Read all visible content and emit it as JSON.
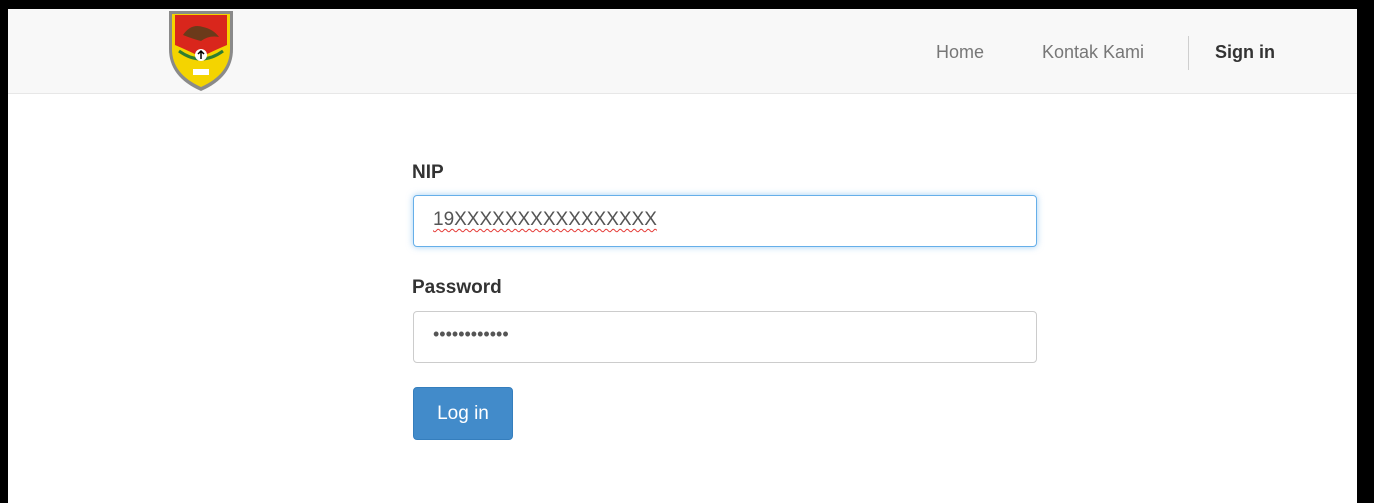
{
  "navbar": {
    "logo_icon": "regency-crest-icon",
    "links": [
      {
        "label": "Home"
      },
      {
        "label": "Kontak Kami"
      }
    ],
    "sign_in_label": "Sign in"
  },
  "form": {
    "nip_label": "NIP",
    "nip_value": "19XXXXXXXXXXXXXXXX",
    "password_label": "Password",
    "password_masked": "••••••••••••",
    "login_label": "Log in"
  },
  "colors": {
    "navbar_bg": "#f8f8f8",
    "primary_button": "#428bca",
    "focus_border": "#66afe9"
  }
}
